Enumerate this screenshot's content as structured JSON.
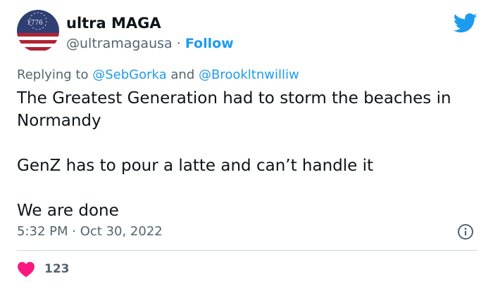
{
  "colors": {
    "text": "#0f1419",
    "secondary": "#536471",
    "accent": "#1d9bf0",
    "like": "#f91880",
    "divider": "#cfd9de"
  },
  "author": {
    "name": "ultra MAGA",
    "handle": "@ultramagausa",
    "separator": "·",
    "follow_label": "Follow",
    "avatar_text": "1776"
  },
  "icons": {
    "brand": "twitter-bird-icon",
    "info": "info-icon",
    "like": "heart-icon"
  },
  "reply": {
    "prefix": "Replying to",
    "mention1": "@SebGorka",
    "conjunction": "and",
    "mention2": "@Brookltnwilliw"
  },
  "body": {
    "line1": "The Greatest Generation had to storm the beaches in Normandy",
    "line2": "GenZ has to pour a latte and can’t handle it",
    "line3": "We are done"
  },
  "meta": {
    "time": "5:32 PM",
    "separator": "·",
    "date": "Oct 30, 2022"
  },
  "engagement": {
    "likes": "123"
  }
}
